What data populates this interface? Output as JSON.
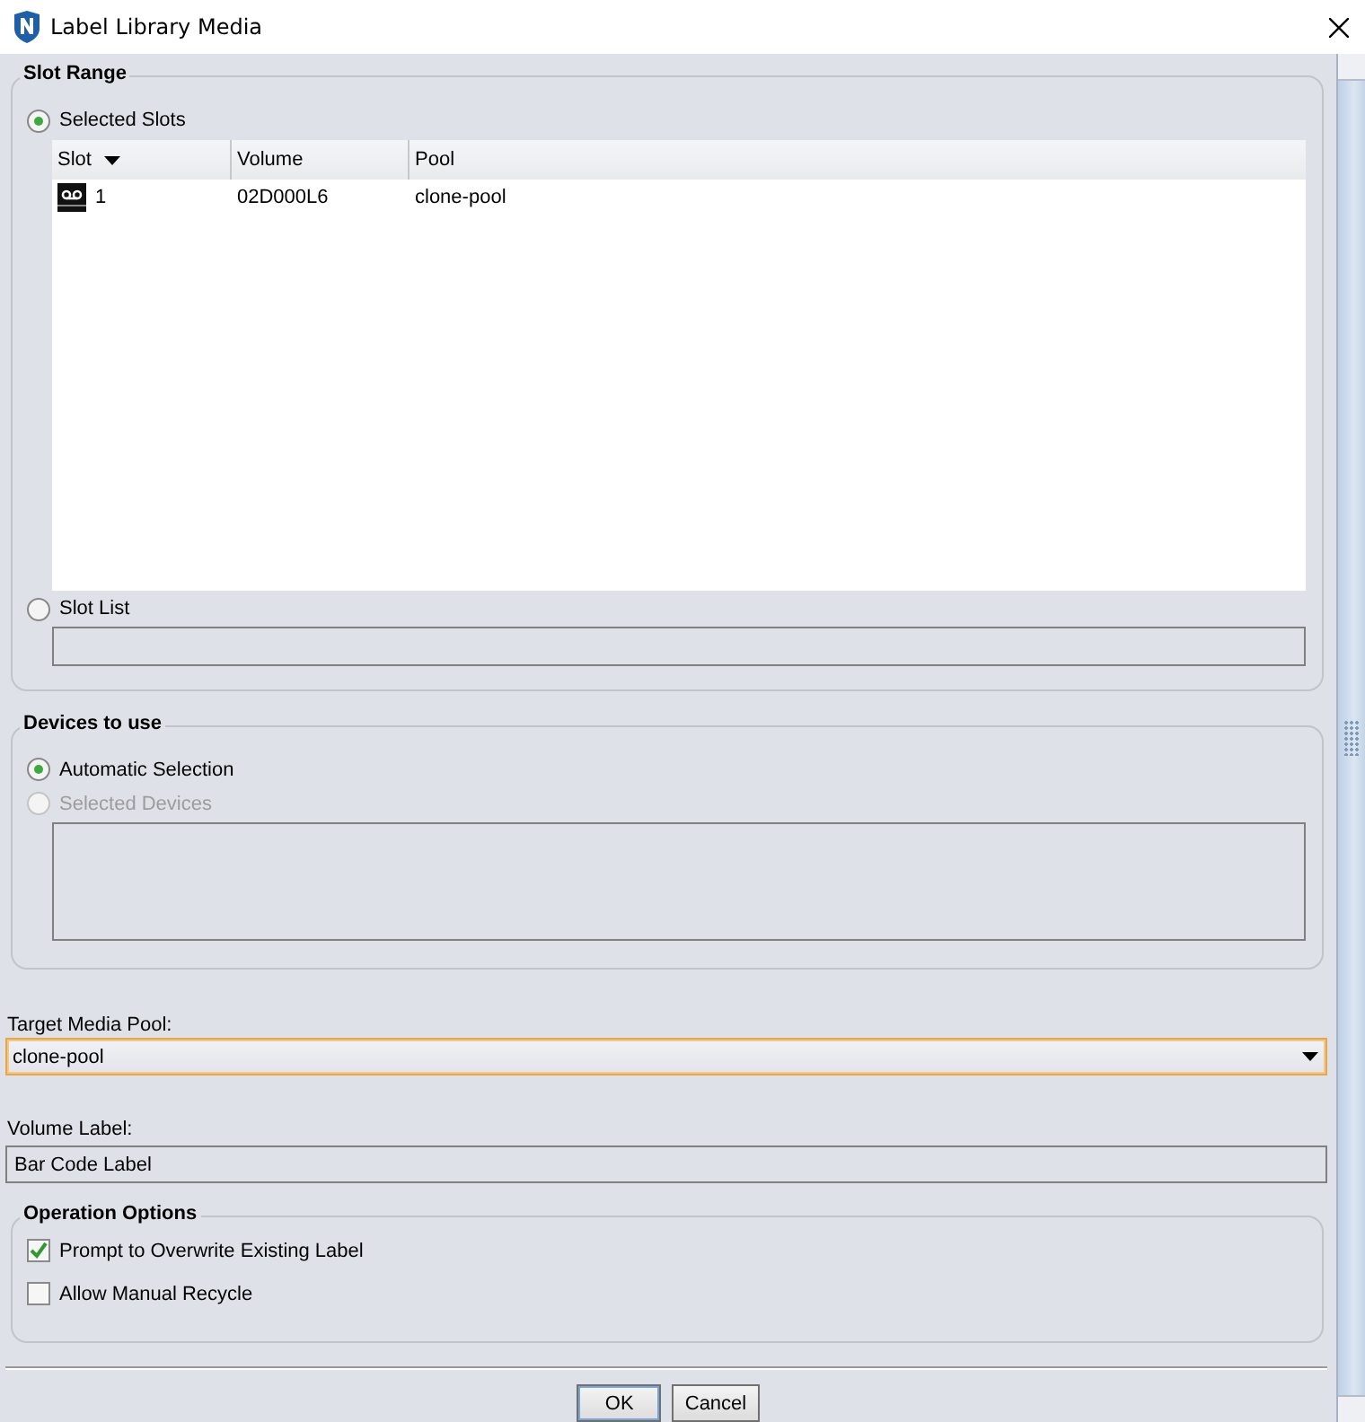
{
  "window": {
    "title": "Label Library Media"
  },
  "slot_range": {
    "title": "Slot Range",
    "options": [
      {
        "kind": "table",
        "label": "Selected Slots",
        "selected": true,
        "disabled": false
      },
      {
        "kind": "field",
        "label": "Slot List",
        "selected": false,
        "disabled": false
      }
    ],
    "table": {
      "columns": [
        {
          "label": "Slot",
          "sorted": true
        },
        {
          "label": "Volume",
          "sorted": false
        },
        {
          "label": "Pool",
          "sorted": false
        }
      ],
      "rows": [
        [
          "1",
          "02D000L6",
          "clone-pool"
        ]
      ]
    }
  },
  "devices": {
    "title": "Devices to use",
    "options": [
      {
        "kind": "plain",
        "label": "Automatic Selection",
        "selected": true,
        "disabled": false
      },
      {
        "kind": "box",
        "label": "Selected Devices",
        "selected": false,
        "disabled": true
      }
    ]
  },
  "target_media_pool": {
    "label": "Target Media Pool:",
    "value": "clone-pool",
    "focused": true
  },
  "volume_label": {
    "label": "Volume Label:",
    "value": "Bar Code Label"
  },
  "operation_options": {
    "title": "Operation Options",
    "checkboxes": [
      {
        "label": "Prompt to Overwrite Existing Label",
        "checked": true
      },
      {
        "label": "Allow Manual Recycle",
        "checked": false
      }
    ]
  },
  "buttons": [
    "OK",
    "Cancel"
  ]
}
